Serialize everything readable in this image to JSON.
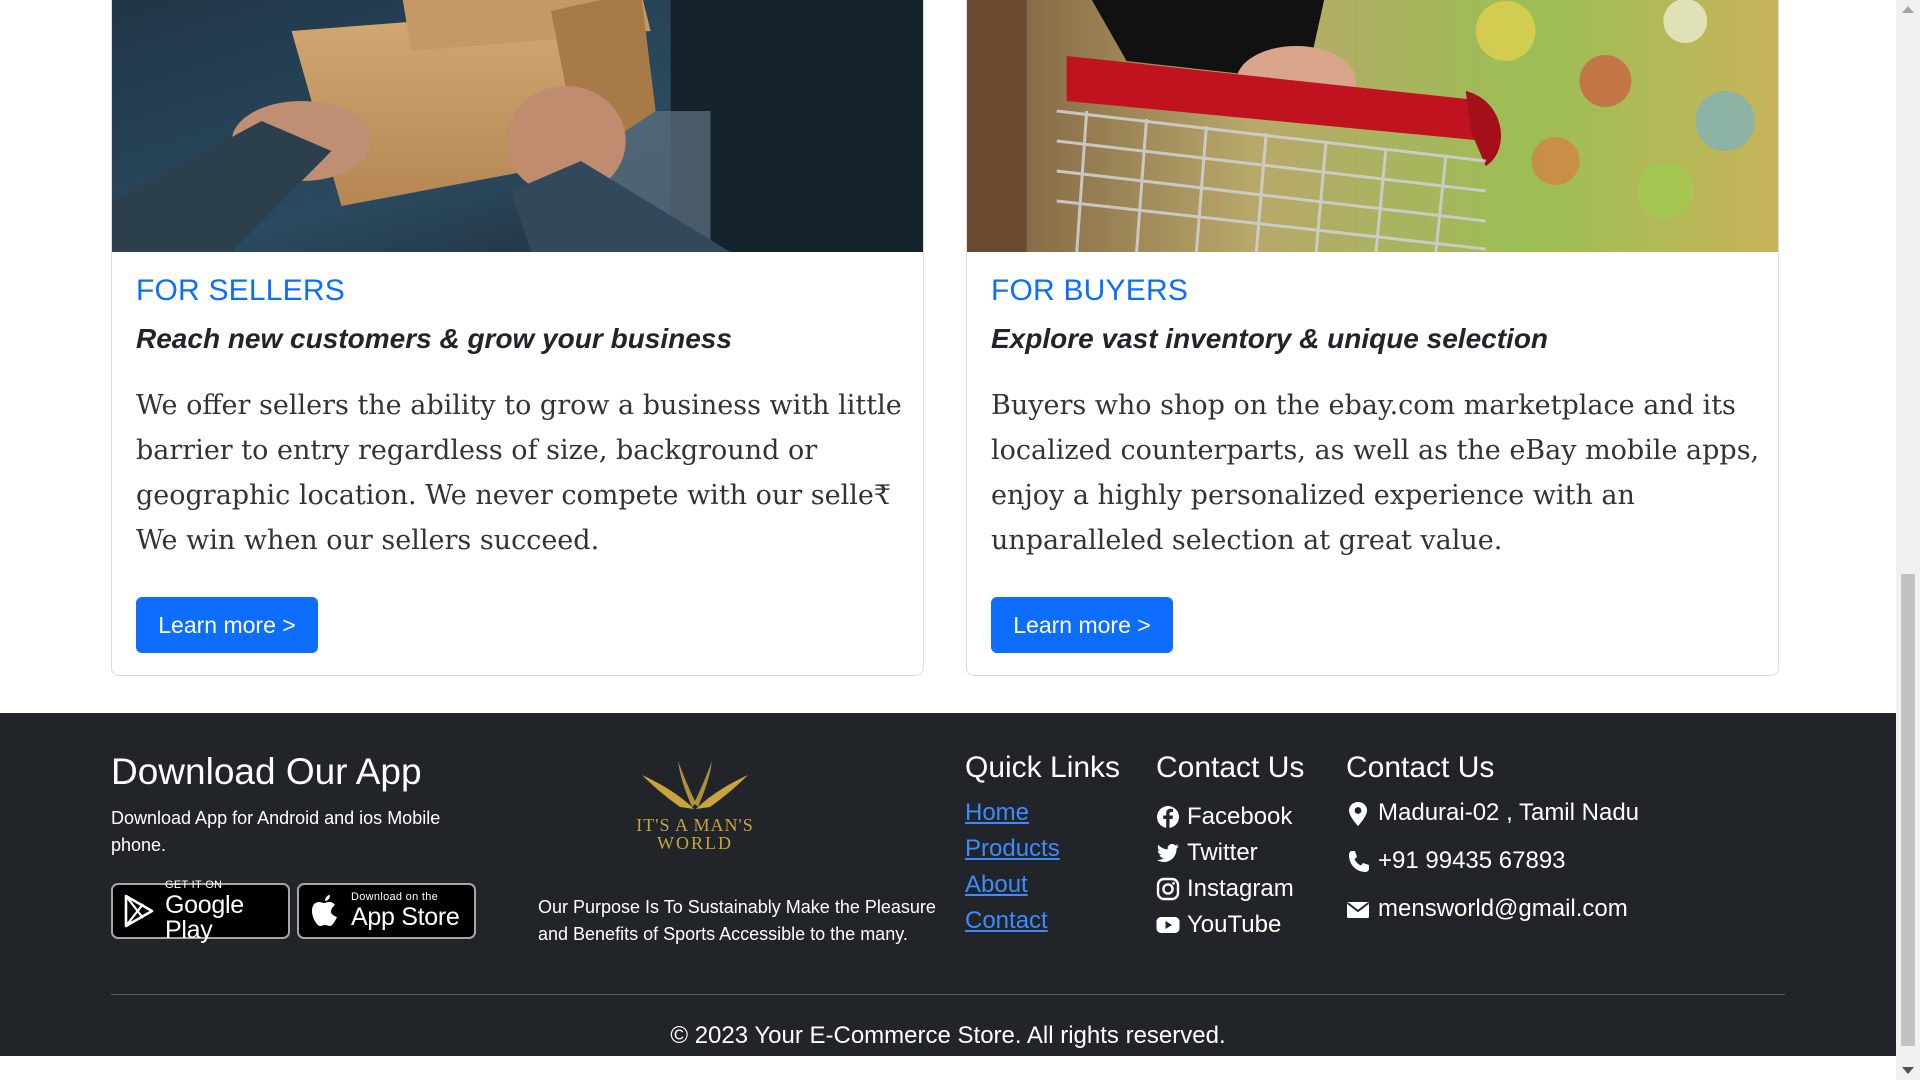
{
  "cards": [
    {
      "title": "FOR SELLERS",
      "subtitle": "Reach new customers & grow your business",
      "text": "We offer sellers the ability to grow a business with little barrier to entry regardless of size, background or geographic location. We never compete with our selle₹ We win when our sellers succeed.",
      "button_label": "Learn more >"
    },
    {
      "title": "FOR BUYERS",
      "subtitle": "Explore vast inventory & unique selection",
      "text": "Buyers who shop on the ebay.com marketplace and its localized counterparts, as well as the eBay mobile apps, enjoy a highly personalized experience with an unparalleled selection at great value.",
      "button_label": "Learn more >"
    }
  ],
  "footer": {
    "download": {
      "heading": "Download Our App",
      "text": "Download App for Android and ios Mobile phone.",
      "google_small": "GET IT ON",
      "google_big": "Google Play",
      "apple_small": "Download on the",
      "apple_big": "App Store"
    },
    "brand": {
      "logo_text": "IT'S A MAN'S WORLD",
      "purpose": "Our Purpose Is To Sustainably Make the Pleasure and Benefits of Sports Accessible to the many."
    },
    "quick_links": {
      "heading": "Quick Links",
      "items": [
        "Home",
        "Products",
        "About",
        "Contact"
      ]
    },
    "social": {
      "heading": "Contact Us",
      "items": [
        {
          "label": "Facebook",
          "icon": "facebook-icon"
        },
        {
          "label": "Twitter",
          "icon": "twitter-icon"
        },
        {
          "label": "Instagram",
          "icon": "instagram-icon"
        },
        {
          "label": "YouTube",
          "icon": "youtube-icon"
        }
      ]
    },
    "contact": {
      "heading": "Contact Us",
      "address": "Madurai-02 , Tamil Nadu",
      "phone": "+91 99435 67893",
      "email": "mensworld@gmail.com"
    },
    "copyright": "© 2023 Your E-Commerce Store. All rights reserved."
  },
  "colors": {
    "accent": "#0d6efd",
    "footer_bg": "#212529",
    "link": "#3d8bfd",
    "logo_gold": "#c9a33d"
  }
}
